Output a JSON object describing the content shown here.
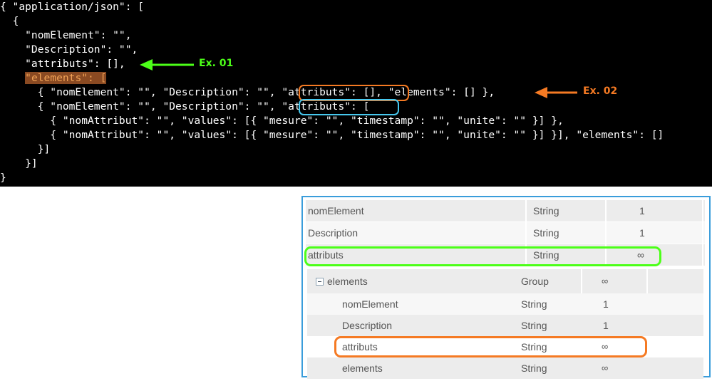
{
  "code": {
    "lines": [
      "{ \"application/json\": [",
      "  {",
      "    \"nomElement\": \"\",",
      "    \"Description\": \"\",",
      "    \"attributs\": [],",
      "    \"elements\": [",
      "      { \"nomElement\": \"\", \"Description\": \"\", \"attributs\": [], \"elements\": [] },",
      "      { \"nomElement\": \"\", \"Description\": \"\", \"attributs\": [",
      "        { \"nomAttribut\": \"\", \"values\": [{ \"mesure\": \"\", \"timestamp\": \"\", \"unite\": \"\" }] },",
      "        { \"nomAttribut\": \"\", \"values\": [{ \"mesure\": \"\", \"timestamp\": \"\", \"unite\": \"\" }] }], \"elements\": []",
      "      }]",
      "    }]",
      "}"
    ],
    "highlighted_key": "\"elements\": ["
  },
  "annotations": {
    "ex01": "Ex. 01",
    "ex02": "Ex. 02"
  },
  "colors": {
    "green": "#4cff18",
    "orange": "#f57a23",
    "cyan": "#47c8ee",
    "table_border": "#3a9ddb",
    "row_dark": "#ececec",
    "row_light": "#f7f7f7"
  },
  "table": {
    "top_rows": [
      {
        "name": "nomElement",
        "type": "String",
        "count": "1"
      },
      {
        "name": "Description",
        "type": "String",
        "count": "1"
      },
      {
        "name": "attributs",
        "type": "String",
        "count": "∞"
      }
    ],
    "group": {
      "name": "elements",
      "type": "Group",
      "count": "∞",
      "icon": "collapse-minus-icon"
    },
    "child_rows": [
      {
        "name": "nomElement",
        "type": "String",
        "count": "1"
      },
      {
        "name": "Description",
        "type": "String",
        "count": "1"
      },
      {
        "name": "attributs",
        "type": "String",
        "count": "∞"
      },
      {
        "name": "elements",
        "type": "String",
        "count": "∞"
      }
    ]
  }
}
